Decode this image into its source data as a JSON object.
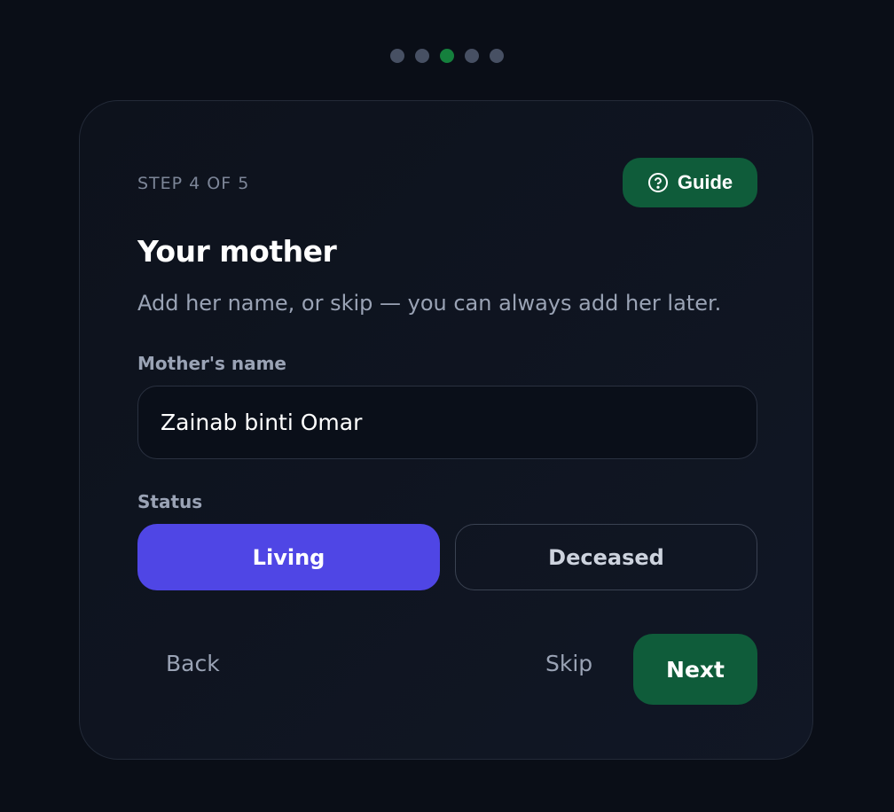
{
  "progress": {
    "total_steps": 5,
    "current_step": 3
  },
  "header": {
    "step_label": "STEP 4 OF 5",
    "guide_label": "Guide",
    "guide_icon": "help-circle-icon"
  },
  "content": {
    "title": "Your mother",
    "subtitle": "Add her name, or skip — you can always add her later."
  },
  "name_field": {
    "label": "Mother's name",
    "value": "Zainab binti Omar"
  },
  "status": {
    "label": "Status",
    "options": [
      "Living",
      "Deceased"
    ],
    "selected": "Living"
  },
  "footer": {
    "back_label": "Back",
    "skip_label": "Skip",
    "next_label": "Next"
  },
  "colors": {
    "background": "#0a0e17",
    "accent_green": "#0f5c3a",
    "selected_purple": "#4f46e5",
    "active_dot": "#15803d",
    "inactive_dot": "#475063"
  }
}
